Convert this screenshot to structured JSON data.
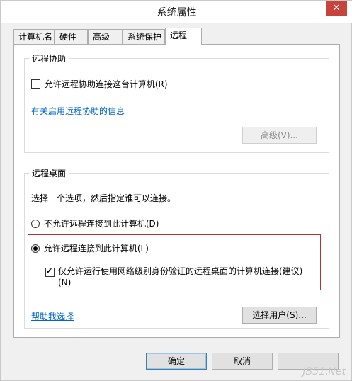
{
  "window": {
    "title": "系统属性",
    "close_label": "✕"
  },
  "tabs": [
    {
      "label": "计算机名"
    },
    {
      "label": "硬件"
    },
    {
      "label": "高级"
    },
    {
      "label": "系统保护"
    },
    {
      "label": "远程",
      "active": true
    }
  ],
  "remote_assistance": {
    "group_label": "远程协助",
    "checkbox_label": "允许远程协助连接这台计算机(R)",
    "checked": false,
    "link": "有关启用远程协助的信息",
    "advanced_button": "高级(V)..."
  },
  "remote_desktop": {
    "group_label": "远程桌面",
    "instruction": "选择一个选项，然后指定谁可以连接。",
    "option_deny": "不允许远程连接到此计算机(D)",
    "option_allow": "允许远程连接到此计算机(L)",
    "selected": "allow",
    "nla_label_line1": "仅允许运行使用网络级别身份验证的远程桌面的计算机连接(建议)",
    "nla_label_line2": "(N)",
    "nla_checked": true,
    "help_link": "帮助我选择",
    "select_users_button": "选择用户(S)..."
  },
  "footer": {
    "ok_button": "确定",
    "cancel_button": "取消"
  },
  "watermark": "JB51.Net",
  "colors": {
    "link": "#0066cc",
    "highlight_border": "#b33333",
    "close_button": "#c7443c"
  }
}
